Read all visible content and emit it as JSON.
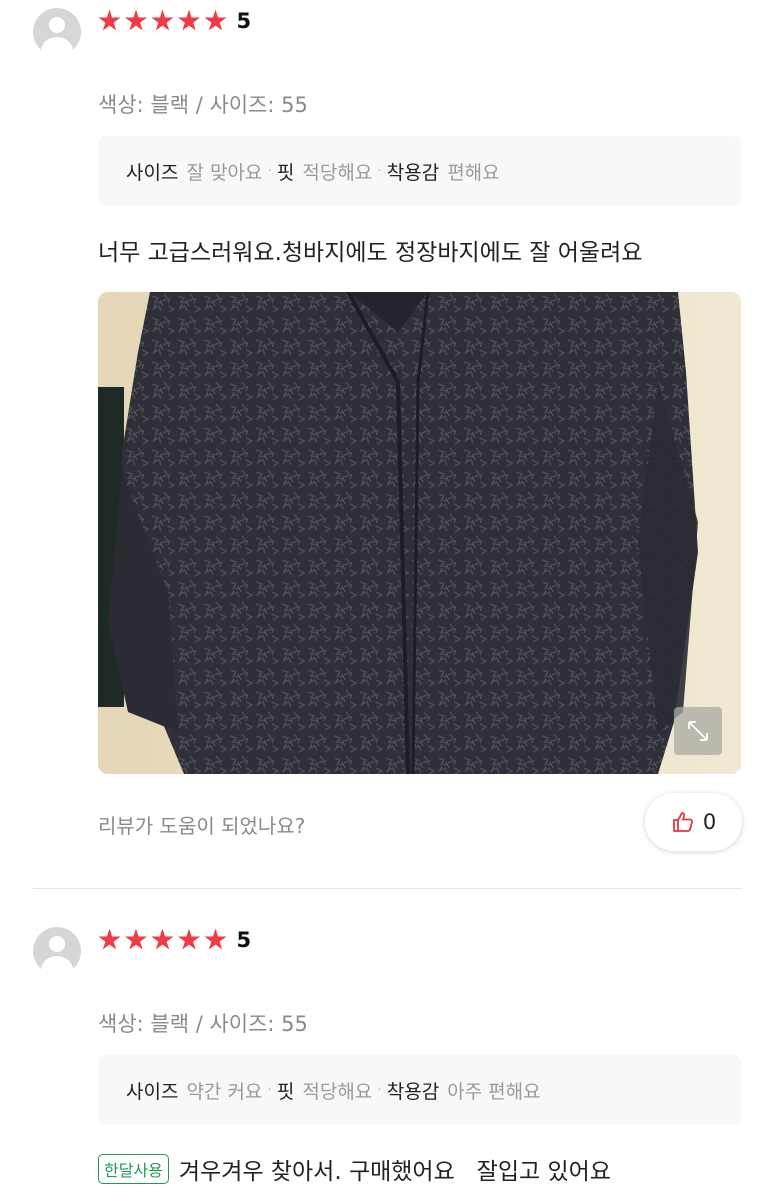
{
  "reviews": [
    {
      "rating": "5",
      "option_text": "색상: 블랙 / 사이즈: 55",
      "attributes": [
        {
          "key": "사이즈",
          "value": "잘 맞아요"
        },
        {
          "key": "핏",
          "value": "적당해요"
        },
        {
          "key": "착용감",
          "value": "편해요"
        }
      ],
      "body": "너무 고급스러워요.청바지에도 정장바지에도 잘 어울려요",
      "helpful_question": "리뷰가 도움이 되었나요?",
      "like_count": "0"
    },
    {
      "rating": "5",
      "option_text": "색상: 블랙 / 사이즈: 55",
      "attributes": [
        {
          "key": "사이즈",
          "value": "약간 커요"
        },
        {
          "key": "핏",
          "value": "적당해요"
        },
        {
          "key": "착용감",
          "value": "아주 편해요"
        }
      ],
      "badge": "한달사용",
      "body": "겨우겨우 찾아서. 구매했어요   잘입고 있어요"
    }
  ],
  "colors": {
    "star": "#f03a46",
    "badge": "#1f9d4f",
    "like_icon": "#e8363f"
  },
  "icons": [
    "avatar-icon",
    "star-icon",
    "expand-icon",
    "thumbs-up-icon"
  ]
}
